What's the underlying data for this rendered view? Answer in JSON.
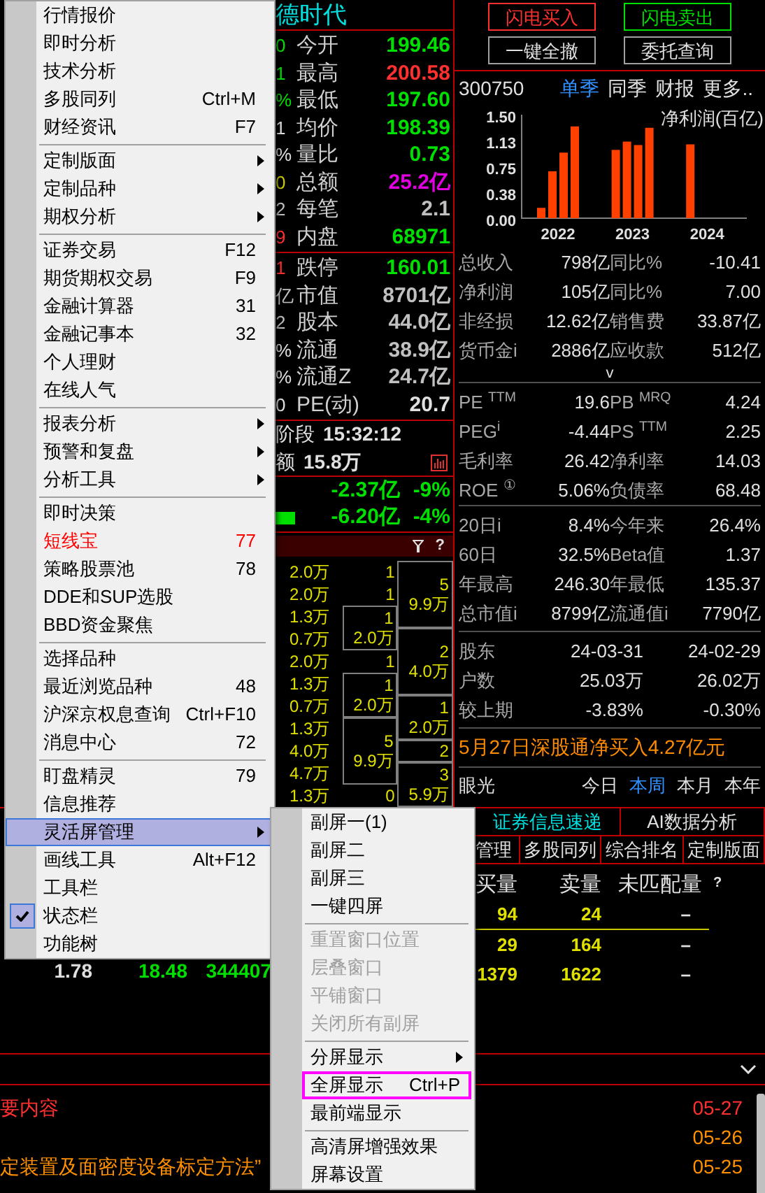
{
  "main_menu": [
    {
      "kind": "item",
      "label": "行情报价",
      "selected": false,
      "checked": false
    },
    {
      "kind": "item",
      "label": "即时分析",
      "selected": false,
      "checked": false
    },
    {
      "kind": "item",
      "label": "技术分析",
      "selected": false,
      "checked": false
    },
    {
      "kind": "item",
      "label": "多股同列",
      "shortcut": "Ctrl+M",
      "selected": false,
      "checked": false
    },
    {
      "kind": "item",
      "label": "财经资讯",
      "shortcut": "F7",
      "selected": false,
      "checked": false
    },
    {
      "kind": "separator"
    },
    {
      "kind": "item",
      "label": "定制版面",
      "submenu": true,
      "selected": false,
      "checked": false
    },
    {
      "kind": "item",
      "label": "定制品种",
      "submenu": true,
      "selected": false,
      "checked": false
    },
    {
      "kind": "item",
      "label": "期权分析",
      "submenu": true,
      "selected": false,
      "checked": false
    },
    {
      "kind": "separator"
    },
    {
      "kind": "item",
      "label": "证券交易",
      "shortcut": "F12",
      "selected": false,
      "checked": false
    },
    {
      "kind": "item",
      "label": "期货期权交易",
      "shortcut": "F9",
      "selected": false,
      "checked": false
    },
    {
      "kind": "item",
      "label": "金融计算器",
      "shortcut": "31",
      "selected": false,
      "checked": false
    },
    {
      "kind": "item",
      "label": "金融记事本",
      "shortcut": "32",
      "selected": false,
      "checked": false
    },
    {
      "kind": "item",
      "label": "个人理财",
      "selected": false,
      "checked": false
    },
    {
      "kind": "item",
      "label": "在线人气",
      "selected": false,
      "checked": false
    },
    {
      "kind": "separator"
    },
    {
      "kind": "item",
      "label": "报表分析",
      "submenu": true,
      "selected": false,
      "checked": false
    },
    {
      "kind": "item",
      "label": "预警和复盘",
      "submenu": true,
      "selected": false,
      "checked": false
    },
    {
      "kind": "item",
      "label": "分析工具",
      "submenu": true,
      "selected": false,
      "checked": false
    },
    {
      "kind": "separator"
    },
    {
      "kind": "item",
      "label": "即时决策",
      "selected": false,
      "checked": false
    },
    {
      "kind": "item",
      "label": "短线宝",
      "shortcut": "77",
      "color": "#ff0000",
      "selected": false,
      "checked": false
    },
    {
      "kind": "item",
      "label": "策略股票池",
      "shortcut": "78",
      "selected": false,
      "checked": false
    },
    {
      "kind": "item",
      "label": "DDE和SUP选股",
      "selected": false,
      "checked": false
    },
    {
      "kind": "item",
      "label": "BBD资金聚焦",
      "selected": false,
      "checked": false
    },
    {
      "kind": "separator"
    },
    {
      "kind": "item",
      "label": "选择品种",
      "selected": false,
      "checked": false
    },
    {
      "kind": "item",
      "label": "最近浏览品种",
      "shortcut": "48",
      "selected": false,
      "checked": false
    },
    {
      "kind": "item",
      "label": "沪深京权息查询",
      "shortcut": "Ctrl+F10",
      "selected": false,
      "checked": false
    },
    {
      "kind": "item",
      "label": "消息中心",
      "shortcut": "72",
      "selected": false,
      "checked": false
    },
    {
      "kind": "separator"
    },
    {
      "kind": "item",
      "label": "盯盘精灵",
      "shortcut": "79",
      "selected": false,
      "checked": false
    },
    {
      "kind": "item",
      "label": "信息推荐",
      "selected": false,
      "checked": false
    },
    {
      "kind": "item",
      "label": "灵活屏管理",
      "submenu": true,
      "selected": true,
      "checked": false
    },
    {
      "kind": "item",
      "label": "画线工具",
      "shortcut": "Alt+F12",
      "selected": false,
      "checked": false
    },
    {
      "kind": "item",
      "label": "工具栏",
      "selected": false,
      "checked": false
    },
    {
      "kind": "item",
      "label": "状态栏",
      "selected": false,
      "checked": true
    },
    {
      "kind": "item",
      "label": "功能树",
      "selected": false,
      "checked": false
    }
  ],
  "submenu": [
    {
      "kind": "item",
      "label": "副屏一(1)",
      "disabled": false,
      "highlighted": false
    },
    {
      "kind": "item",
      "label": "副屏二",
      "disabled": false,
      "highlighted": false
    },
    {
      "kind": "item",
      "label": "副屏三",
      "disabled": false,
      "highlighted": false
    },
    {
      "kind": "item",
      "label": "一键四屏",
      "disabled": false,
      "highlighted": false
    },
    {
      "kind": "separator"
    },
    {
      "kind": "item",
      "label": "重置窗口位置",
      "disabled": true,
      "highlighted": false
    },
    {
      "kind": "item",
      "label": "层叠窗口",
      "disabled": true,
      "highlighted": false
    },
    {
      "kind": "item",
      "label": "平铺窗口",
      "disabled": true,
      "highlighted": false
    },
    {
      "kind": "item",
      "label": "关闭所有副屏",
      "disabled": true,
      "highlighted": false
    },
    {
      "kind": "separator"
    },
    {
      "kind": "item",
      "label": "分屏显示",
      "submenu": true,
      "disabled": false,
      "highlighted": false
    },
    {
      "kind": "item",
      "label": "全屏显示",
      "shortcut": "Ctrl+P",
      "disabled": false,
      "highlighted": true
    },
    {
      "kind": "item",
      "label": "最前端显示",
      "disabled": false,
      "highlighted": false
    },
    {
      "kind": "separator"
    },
    {
      "kind": "item",
      "label": "高清屏增强效果",
      "disabled": false,
      "highlighted": false
    },
    {
      "kind": "item",
      "label": "屏幕设置",
      "disabled": false,
      "highlighted": false
    }
  ],
  "quote": {
    "title": "德时代",
    "rows": [
      {
        "prefix": {
          "text": "0",
          "color": "#00e000"
        },
        "label": "今开",
        "value": "199.46",
        "color": "#00e000"
      },
      {
        "prefix": {
          "text": "1",
          "color": "#00e000"
        },
        "label": "最高",
        "value": "200.58",
        "color": "#ff3030"
      },
      {
        "prefix": {
          "text": "%",
          "color": "#00e000"
        },
        "label": "最低",
        "value": "197.60",
        "color": "#00e000"
      },
      {
        "prefix": {
          "text": "1",
          "color": "#e0e0e0"
        },
        "label": "均价",
        "value": "198.39",
        "color": "#00e000"
      },
      {
        "prefix": {
          "text": "%",
          "color": "#e0e0e0"
        },
        "label": "量比",
        "value": "0.73",
        "color": "#00e000"
      },
      {
        "prefix": {
          "text": "0",
          "color": "#c8c800"
        },
        "label": "总额",
        "value": "25.2亿",
        "color": "#e000e0"
      },
      {
        "prefix": {
          "text": "2",
          "color": "#c0c0c0"
        },
        "label": "每笔",
        "value": "2.1",
        "color": "#c0c0c0"
      },
      {
        "prefix": {
          "text": "9",
          "color": "#ff3030"
        },
        "label": "内盘",
        "value": "68971",
        "color": "#00e000"
      }
    ],
    "rows2": [
      {
        "prefix": {
          "text": "1",
          "color": "#ff3030"
        },
        "label": "跌停",
        "value": "160.01",
        "color": "#00e000"
      },
      {
        "prefix": {
          "text": "亿",
          "color": "#c0c0c0"
        },
        "label": "市值",
        "value": "8701亿",
        "color": "#c0c0c0"
      },
      {
        "prefix": {
          "text": "2",
          "color": "#c0c0c0"
        },
        "label": "股本",
        "value": "44.0亿",
        "color": "#c0c0c0"
      },
      {
        "prefix": {
          "text": "%",
          "color": "#e0e0e0"
        },
        "label": "流通",
        "value": "38.9亿",
        "color": "#c0c0c0"
      },
      {
        "prefix": {
          "text": "%",
          "color": "#e0e0e0"
        },
        "label": "流通Z",
        "value": "24.7亿",
        "color": "#c0c0c0"
      },
      {
        "prefix": {
          "text": "0",
          "color": "#e0e0e0"
        },
        "label": "PE(动)",
        "value": "20.7",
        "color": "#e0e0e0"
      }
    ],
    "phase": {
      "label": "阶段",
      "time": "15:32:12"
    },
    "amount": {
      "label": "额",
      "value": "15.8万"
    },
    "flows": [
      {
        "value": "-2.37亿",
        "pct": "-9%",
        "bar": false
      },
      {
        "value": "-6.20亿",
        "pct": "-4%",
        "bar": true
      }
    ]
  },
  "order_book": {
    "help": "?",
    "volumes": [
      "2.0万",
      "2.0万",
      "1.3万",
      "0.7万",
      "2.0万",
      "1.3万",
      "0.7万",
      "1.3万",
      "4.0万",
      "4.7万",
      "1.3万"
    ],
    "column_2": [
      {
        "kind": "single",
        "boxed": false,
        "lines": [
          "1"
        ]
      },
      {
        "kind": "single",
        "boxed": false,
        "lines": [
          "1"
        ]
      },
      {
        "kind": "double",
        "boxed": true,
        "lines": [
          "1",
          "2.0万"
        ]
      },
      {
        "kind": "single",
        "boxed": false,
        "lines": [
          "1"
        ]
      },
      {
        "kind": "double",
        "boxed": true,
        "lines": [
          "1",
          "2.0万"
        ]
      },
      {
        "kind": "triple",
        "boxed": true,
        "lines": [
          "5",
          "9.9万"
        ]
      },
      {
        "kind": "single",
        "boxed": false,
        "lines": [
          "0"
        ]
      }
    ],
    "column_3": [
      {
        "kind": "triple",
        "boxed": true,
        "lines": [
          "5",
          "9.9万"
        ]
      },
      {
        "kind": "triple",
        "boxed": true,
        "lines": [
          "2",
          "4.0万"
        ]
      },
      {
        "kind": "double",
        "boxed": true,
        "lines": [
          "1",
          "2.0万"
        ]
      },
      {
        "kind": "single",
        "boxed": true,
        "lines": [
          "2"
        ]
      },
      {
        "kind": "double",
        "boxed": true,
        "lines": [
          "3",
          "5.9万"
        ]
      }
    ]
  },
  "trade_buttons": [
    {
      "label": "闪电买入",
      "kind": "buy"
    },
    {
      "label": "闪电卖出",
      "kind": "sell"
    },
    {
      "label": "一键全撤",
      "kind": "plain"
    },
    {
      "label": "委托查询",
      "kind": "plain"
    }
  ],
  "finance": {
    "code": "300750",
    "tabs": [
      {
        "label": "单季",
        "selected": true
      },
      {
        "label": "同季",
        "selected": false
      },
      {
        "label": "财报",
        "selected": false
      },
      {
        "label": "更多..",
        "selected": false
      }
    ],
    "chart_data": {
      "type": "bar",
      "title": "净利润(百亿)",
      "categories": [
        "2022",
        "2023",
        "2024"
      ],
      "ylim": [
        0,
        1.5
      ],
      "yticks": [
        {
          "value": 0,
          "label": "0.00"
        },
        {
          "value": 0.38,
          "label": "0.38"
        },
        {
          "value": 0.75,
          "label": "0.75"
        },
        {
          "value": 1.13,
          "label": "1.13"
        },
        {
          "value": 1.5,
          "label": "1.50"
        }
      ],
      "series": [
        {
          "color": "#ff4000",
          "values": [
            0.15,
            0.99,
            1.07
          ]
        },
        {
          "color": "#ff4000",
          "values": [
            0.68,
            1.11,
            null
          ]
        },
        {
          "color": "#ff4000",
          "values": [
            0.95,
            1.06,
            null
          ]
        },
        {
          "color": "#ff4000",
          "values": [
            1.33,
            1.31,
            null
          ]
        }
      ]
    },
    "groups": [
      [
        {
          "label": "总收入",
          "value": "798亿",
          "label2": "同比%",
          "value2": "-10.41"
        },
        {
          "label": "净利润",
          "value": "105亿",
          "label2": "同比%",
          "value2": "7.00"
        },
        {
          "label": "非经损",
          "value": "12.62亿",
          "label2": "销售费",
          "value2": "33.87亿"
        },
        {
          "label": "货币金i",
          "value": "2886亿",
          "label2": "应收款",
          "value2": "512亿"
        }
      ],
      [
        {
          "label": "PE $^{TTM}$",
          "value": "19.6",
          "label2": "PB $^{MRQ}$",
          "value2": "4.24"
        },
        {
          "label": "PEG$^{i}$",
          "value": "-4.44",
          "label2": "PS $^{TTM}$",
          "value2": "2.25"
        },
        {
          "label": "毛利率",
          "value": "26.42",
          "label2": "净利率",
          "value2": "14.03"
        },
        {
          "label": "ROE $^{①}$",
          "value": "5.06%",
          "label2": "负债率",
          "value2": "68.48"
        }
      ],
      [
        {
          "label": "20日i",
          "value": "8.4%",
          "label2": "今年来",
          "value2": "26.4%"
        },
        {
          "label": "60日",
          "value": "32.5%",
          "label2": "Beta值",
          "value2": "1.37"
        },
        {
          "label": "年最高",
          "value": "246.30",
          "label2": "年最低",
          "value2": "135.37"
        },
        {
          "label": "总市值i",
          "value": "8799亿",
          "label2": "流通值i",
          "value2": "7790亿"
        }
      ]
    ],
    "expand": "v",
    "holders": [
      {
        "label": "股东",
        "value": "24-03-31",
        "value2": "24-02-29"
      },
      {
        "label": "户数",
        "value": "25.03万",
        "value2": "26.02万"
      },
      {
        "label": "较上期",
        "value": "-3.83%",
        "value2": "-0.30%"
      }
    ],
    "headline": "5月27日深股通净买入4.27亿元",
    "vision": {
      "label": "眼光",
      "periods": [
        {
          "label": "今日",
          "selected": false
        },
        {
          "label": "本周",
          "selected": true
        },
        {
          "label": "本月",
          "selected": false
        },
        {
          "label": "本年",
          "selected": false
        }
      ]
    }
  },
  "info_tabs": [
    {
      "label": "证券信息速递",
      "selected": true
    },
    {
      "label": "AI数据分析",
      "selected": false
    }
  ],
  "tool_tabs": [
    "管理",
    "多股同列",
    "综合排名",
    "定制版面"
  ],
  "auction": {
    "columns": [
      "买量",
      "卖量",
      "未匹配量"
    ],
    "help": "?",
    "rows": [
      [
        "94",
        "24",
        "–"
      ],
      [
        "29",
        "164",
        "–"
      ],
      [
        "1379",
        "1622",
        "–"
      ]
    ]
  },
  "stock_row": [
    "1.78",
    "18.48",
    "344407"
  ],
  "news": [
    {
      "title": "要内容",
      "date": "05-27",
      "color": "#ff3030"
    },
    {
      "date": "05-26",
      "color": "#ff9000"
    },
    {
      "title": "定装置及面密度设备标定方法”",
      "date": "05-25",
      "color": "#ff9000"
    }
  ]
}
